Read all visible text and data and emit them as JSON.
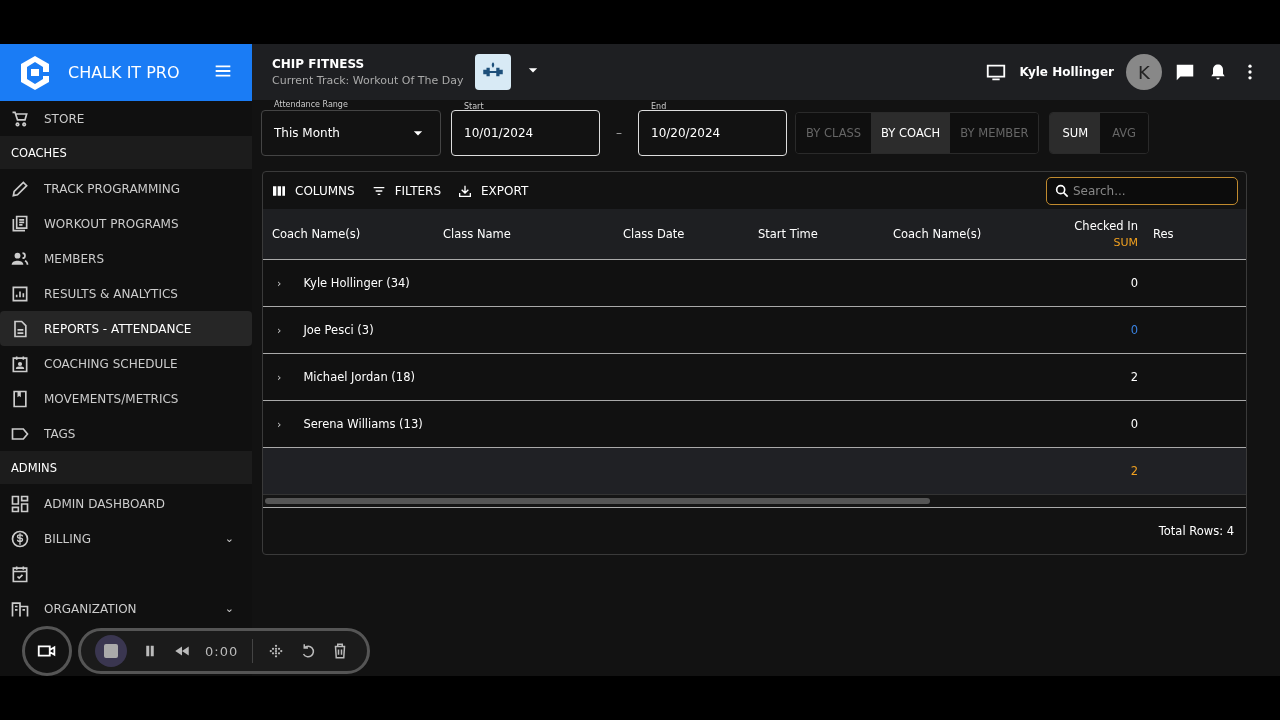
{
  "brand": {
    "name": "CHALK IT PRO"
  },
  "sidebar": {
    "items": [
      {
        "kind": "item",
        "label": "STORE",
        "selected": false
      },
      {
        "kind": "section",
        "label": "COACHES"
      },
      {
        "kind": "item",
        "label": "TRACK PROGRAMMING",
        "selected": false
      },
      {
        "kind": "item",
        "label": "WORKOUT PROGRAMS",
        "selected": false
      },
      {
        "kind": "item",
        "label": "MEMBERS",
        "selected": false
      },
      {
        "kind": "item",
        "label": "RESULTS & ANALYTICS",
        "selected": false
      },
      {
        "kind": "item",
        "label": "REPORTS - ATTENDANCE",
        "selected": true
      },
      {
        "kind": "item",
        "label": "COACHING SCHEDULE",
        "selected": false
      },
      {
        "kind": "item",
        "label": "MOVEMENTS/METRICS",
        "selected": false
      },
      {
        "kind": "item",
        "label": "TAGS",
        "selected": false
      },
      {
        "kind": "section",
        "label": "ADMINS"
      },
      {
        "kind": "item",
        "label": "ADMIN DASHBOARD",
        "selected": false
      },
      {
        "kind": "item",
        "label": "BILLING",
        "selected": false,
        "chevron": "⌄"
      },
      {
        "kind": "item",
        "selected": false
      },
      {
        "kind": "item",
        "label": "ORGANIZATION",
        "selected": false,
        "chevron": "⌄"
      }
    ]
  },
  "header": {
    "gym": "CHIP FITNESS",
    "track": "Current Track: Workout Of The Day",
    "user": "Kyle Hollinger",
    "avatar": "K"
  },
  "filters": {
    "range": {
      "label": "Attendance Range",
      "value": "This Month"
    },
    "start": {
      "label": "Start",
      "value": "10/01/2024"
    },
    "separator": "–",
    "end": {
      "label": "End",
      "value": "10/20/2024"
    },
    "group_by": [
      {
        "label": "BY CLASS",
        "selected": false
      },
      {
        "label": "BY COACH",
        "selected": true
      },
      {
        "label": "BY MEMBER",
        "selected": false
      }
    ],
    "aggregate": [
      {
        "label": "SUM",
        "selected": true
      },
      {
        "label": "AVG",
        "selected": false
      }
    ]
  },
  "toolbar": {
    "buttons": [
      {
        "label": "COLUMNS"
      },
      {
        "label": "FILTERS"
      },
      {
        "label": "EXPORT"
      }
    ],
    "search": {
      "placeholder": "Search..."
    }
  },
  "table": {
    "columns": [
      {
        "label": "Coach Name(s)"
      },
      {
        "label": "Class Name"
      },
      {
        "label": "Class Date"
      },
      {
        "label": "Start Time"
      },
      {
        "label": "Coach Name(s)"
      },
      {
        "label": "Checked In",
        "sub": "SUM"
      },
      {
        "label": "Res"
      }
    ],
    "rows": [
      {
        "expander": "›",
        "name": "Kyle Hollinger (34)",
        "checked_in": "0",
        "highlighted": false
      },
      {
        "expander": "›",
        "name": "Joe Pesci (3)",
        "checked_in": "0",
        "highlighted": true
      },
      {
        "expander": "›",
        "name": "Michael Jordan (18)",
        "checked_in": "2",
        "highlighted": false
      },
      {
        "expander": "›",
        "name": "Serena Williams (13)",
        "checked_in": "0",
        "highlighted": false
      }
    ],
    "total": "2",
    "footer": "Total Rows: 4"
  },
  "recorder": {
    "time": "0:00"
  }
}
